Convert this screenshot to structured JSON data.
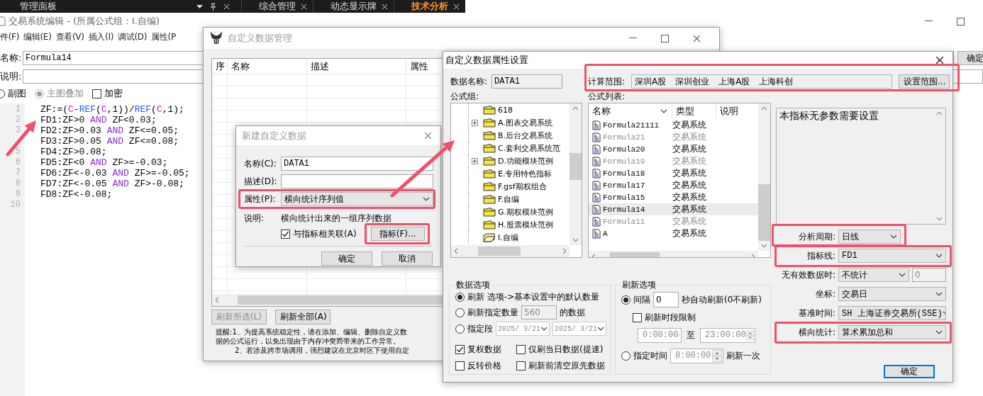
{
  "top_bar": {
    "title": "管理面板",
    "tabs": [
      {
        "label": "综合管理",
        "selected": false
      },
      {
        "label": "动态显示牌",
        "selected": false
      },
      {
        "label": "技术分析",
        "selected": true
      }
    ]
  },
  "editor": {
    "title": "交易系统编辑 - (所属公式组：I.自编)",
    "menu": [
      "件(F)",
      "编辑(E)",
      "查看(V)",
      "插入(I)",
      "调试(D)",
      "属性(P"
    ],
    "name_label": "名称:",
    "name_value": "Formula14",
    "desc_label": "说明:",
    "ok_button": "确定",
    "options": [
      {
        "kind": "radio",
        "label": "副图",
        "selected": false,
        "disabled": false
      },
      {
        "kind": "radio",
        "label": "主图叠加",
        "selected": true,
        "disabled": true
      },
      {
        "kind": "checkbox",
        "label": "加密",
        "checked": false
      }
    ],
    "code": [
      {
        "number": "1",
        "tokens": [
          {
            "text": "ZF:=(",
            "kind": "plain"
          },
          {
            "text": "C",
            "kind": "var"
          },
          {
            "text": "-",
            "kind": "plain"
          },
          {
            "text": "REF",
            "kind": "func"
          },
          {
            "text": "(",
            "kind": "plain"
          },
          {
            "text": "C",
            "kind": "var"
          },
          {
            "text": ",1))/",
            "kind": "plain"
          },
          {
            "text": "REF",
            "kind": "func"
          },
          {
            "text": "(",
            "kind": "plain"
          },
          {
            "text": "C",
            "kind": "var"
          },
          {
            "text": ",1);",
            "kind": "plain"
          }
        ]
      },
      {
        "number": "2",
        "tokens": [
          {
            "text": "FD1:ZF>0 ",
            "kind": "plain"
          },
          {
            "text": "AND",
            "kind": "keyword"
          },
          {
            "text": " ZF<0.03;",
            "kind": "plain"
          }
        ]
      },
      {
        "number": "3",
        "tokens": [
          {
            "text": "FD2:ZF>0.03 ",
            "kind": "plain"
          },
          {
            "text": "AND",
            "kind": "keyword"
          },
          {
            "text": " ZF<=0.05;",
            "kind": "plain"
          }
        ]
      },
      {
        "tokens": [
          {
            "text": "FD3:ZF>0.05 ",
            "kind": "plain"
          },
          {
            "text": "AND",
            "kind": "keyword"
          },
          {
            "text": " ZF<=0.08;",
            "kind": "plain"
          }
        ]
      },
      {
        "number": "5",
        "tokens": [
          {
            "text": "FD4:ZF>0.08;",
            "kind": "plain"
          }
        ]
      },
      {
        "number": "6",
        "tokens": [
          {
            "text": "FD5:ZF<0 ",
            "kind": "plain"
          },
          {
            "text": "AND",
            "kind": "keyword"
          },
          {
            "text": " ZF>=-0.03;",
            "kind": "plain"
          }
        ]
      },
      {
        "number": "7",
        "tokens": [
          {
            "text": "FD6:ZF<-0.03 ",
            "kind": "plain"
          },
          {
            "text": "AND",
            "kind": "keyword"
          },
          {
            "text": " ZF>=-0.05;",
            "kind": "plain"
          }
        ]
      },
      {
        "number": "8",
        "tokens": [
          {
            "text": "FD7:ZF<-0.05 ",
            "kind": "plain"
          },
          {
            "text": "AND",
            "kind": "keyword"
          },
          {
            "text": " ZF>-0.08;",
            "kind": "plain"
          }
        ]
      },
      {
        "number": "9",
        "tokens": [
          {
            "text": "FD8:ZF<-0.08;",
            "kind": "plain"
          }
        ]
      },
      {
        "number": "10"
      }
    ]
  },
  "data_manager": {
    "title": "自定义数据管理",
    "columns": [
      "序",
      "名称",
      "描述",
      "属性"
    ],
    "buttons": [
      {
        "label": "刷新所选(L)",
        "disabled": true
      },
      {
        "label": "刷新全部(A)",
        "disabled": false
      }
    ],
    "notice": [
      "提醒:1、为提高系统稳定性，请在添加、编辑、删除自定义数",
      "据的公式运行，以免出现由于内存冲突而带来的工作异常。",
      "2、若涉及跨市场调用，强烈建议在北京时区下使用自定"
    ]
  },
  "new_data_dialog": {
    "title": "新建自定义数据",
    "fields": [
      {
        "label": "名称(C):",
        "value": "DATA1"
      },
      {
        "label": "描述(D):"
      }
    ],
    "property": {
      "label": "属性(P):",
      "value": "横向统计序列值",
      "highlighted": true
    },
    "note_label": "说明:",
    "note": "横向统计出来的一组序列数据",
    "link": {
      "label": "与指标相关联(A)",
      "checked": true
    },
    "indicator_button": {
      "label": "指标(F)...",
      "highlighted": true
    },
    "buttons": [
      "确定",
      "取消"
    ]
  },
  "property_dialog": {
    "title": "自定义数据属性设置",
    "data_name": {
      "label": "数据名称:",
      "value": "DATA1"
    },
    "scope": {
      "label": "计算范围:",
      "markets": [
        "深圳A股",
        "深圳创业",
        "上海A股",
        "上海科创"
      ],
      "button": "设置范围...",
      "highlighted": true
    },
    "group_label": "公式组:",
    "list_label": "公式列表:",
    "groups": [
      {
        "label": "618",
        "expandable": false,
        "open": false
      },
      {
        "label": "A.图表交易系统",
        "expandable": true,
        "open": false
      },
      {
        "label": "B.后台交易系统",
        "expandable": false,
        "open": false
      },
      {
        "label": "C.套利交易系统范",
        "expandable": false,
        "open": false
      },
      {
        "label": "D.功能模块范例",
        "expandable": true,
        "open": false
      },
      {
        "label": "E.专用特色指标",
        "expandable": false,
        "open": false
      },
      {
        "label": "F.gsf期权组合",
        "expandable": false,
        "open": false
      },
      {
        "label": "F.自编",
        "expandable": false,
        "open": false
      },
      {
        "label": "G.期权模块范例",
        "expandable": false,
        "open": false
      },
      {
        "label": "H.股票模块范例",
        "expandable": false,
        "open": false
      },
      {
        "label": "I.自编",
        "expandable": false,
        "open": true
      }
    ],
    "formula_columns": [
      "名称",
      "类型",
      "说明"
    ],
    "formulas": [
      {
        "name": "Formula21111",
        "type": "交易系统",
        "disabled": false,
        "selected": false
      },
      {
        "name": "Formula21",
        "type": "交易系统",
        "disabled": true,
        "selected": false
      },
      {
        "name": "Formula20",
        "type": "交易系统",
        "disabled": false,
        "selected": false
      },
      {
        "name": "Formula19",
        "type": "交易系统",
        "disabled": true,
        "selected": false
      },
      {
        "name": "Formula18",
        "type": "交易系统",
        "disabled": false,
        "selected": false
      },
      {
        "name": "Formula17",
        "type": "交易系统",
        "disabled": false,
        "selected": false
      },
      {
        "name": "Formula15",
        "type": "交易系统",
        "disabled": false,
        "selected": false
      },
      {
        "name": "Formula14",
        "type": "交易系统",
        "disabled": false,
        "selected": true
      },
      {
        "name": "Formula11",
        "type": "交易系统",
        "disabled": true,
        "selected": false
      },
      {
        "name": "A",
        "type": "交易系统",
        "disabled": false,
        "selected": false
      }
    ],
    "params_text": "本指标无参数需要设置",
    "settings": [
      {
        "kind": "short",
        "label": "分析周期:",
        "value": "日线",
        "highlighted": true
      },
      {
        "kind": "wide",
        "label": "指标线:",
        "value": "FD1",
        "highlighted": true
      },
      {
        "kind": "with_field",
        "label": "无有效数据时:",
        "value": "不统计",
        "extra": "0",
        "highlighted": false
      },
      {
        "kind": "wide",
        "label": "坐标:",
        "value": "交易日",
        "highlighted": false
      },
      {
        "kind": "wide",
        "label": "基准时间:",
        "value": "SH 上海证券交易所(SSE)",
        "highlighted": false
      },
      {
        "kind": "wide",
        "label": "横向统计:",
        "value": "算术累加总和",
        "highlighted": true
      }
    ],
    "data_options": {
      "title": "数据选项",
      "modes": [
        {
          "kind": "plain",
          "label": "刷新 选项->基本设置中的默认数量",
          "selected": true
        },
        {
          "kind": "count",
          "label": "刷新指定数量",
          "value": "560",
          "suffix": "的数据",
          "selected": false
        },
        {
          "kind": "range",
          "label": "指定段",
          "from": "2025/ 3/21",
          "to": "2025/ 3/21",
          "selected": false
        }
      ],
      "checks": [
        {
          "label": "复权数据",
          "checked": true
        },
        {
          "label": "仅刷当日数据(提速)",
          "checked": false
        },
        {
          "label": "反转价格",
          "checked": false
        },
        {
          "label": "刷新前清空原先数据",
          "checked": false
        }
      ]
    },
    "refresh_options": {
      "title": "刷新选项",
      "interval": {
        "label": "间隔",
        "value": "0",
        "suffix": "秒自动刷新(0不刷新)",
        "selected": true
      },
      "limit": {
        "label": "刷新时段限制",
        "checked": false
      },
      "start": "0:00:00",
      "range_word": "至",
      "end": "23:00:00",
      "timed": {
        "label": "指定时间",
        "value": "8:00:00",
        "suffix": "刷新一次",
        "selected": false
      }
    },
    "ok_button": "确定"
  }
}
